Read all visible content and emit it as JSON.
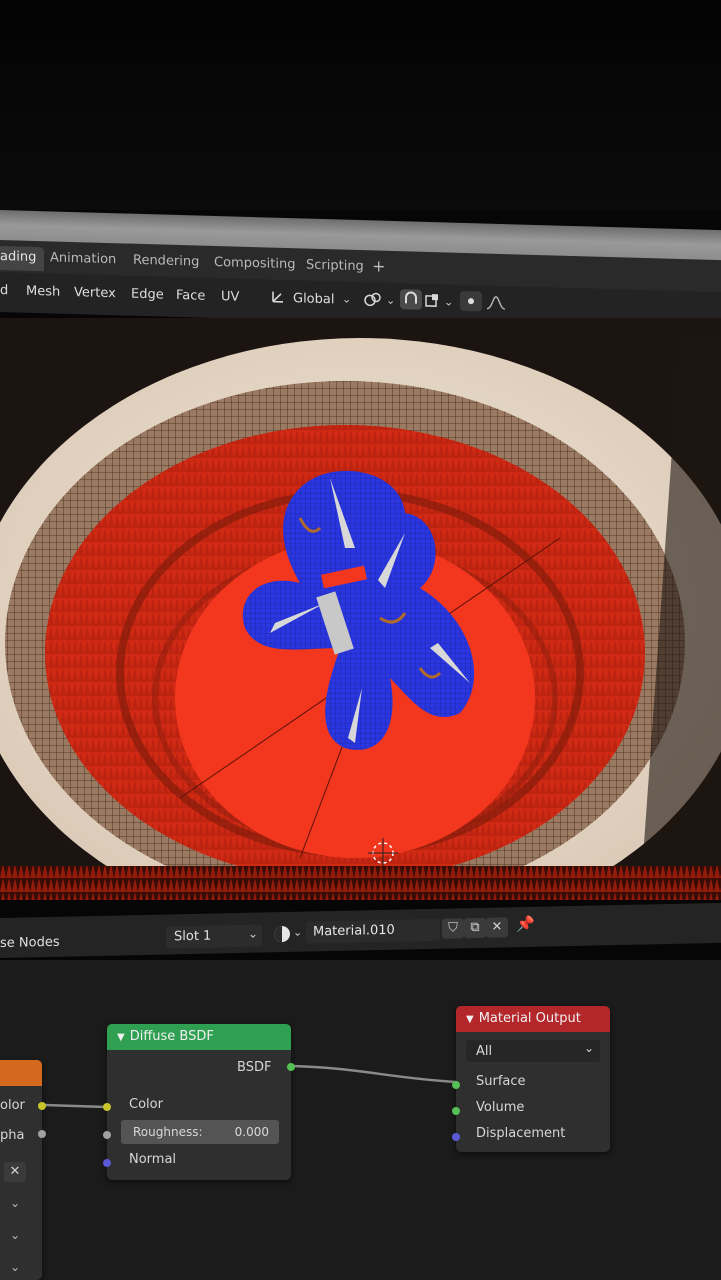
{
  "workspace_tabs": [
    {
      "label": "ading",
      "active": true
    },
    {
      "label": "Animation",
      "active": false
    },
    {
      "label": "Rendering",
      "active": false
    },
    {
      "label": "Compositing",
      "active": false
    },
    {
      "label": "Scripting",
      "active": false
    }
  ],
  "tab_add": "+",
  "header_menu": [
    "d",
    "Mesh",
    "Vertex",
    "Edge",
    "Face",
    "UV"
  ],
  "transform_orientation": "Global",
  "node_header": {
    "use_nodes_label": "se Nodes",
    "slot": "Slot 1",
    "material": "Material.010"
  },
  "nodes": {
    "diffuse": {
      "title": "Diffuse BSDF",
      "output": "BSDF",
      "color_label": "Color",
      "roughness_label": "Roughness:",
      "roughness_value": "0.000",
      "normal_label": "Normal"
    },
    "output": {
      "title": "Material Output",
      "target": "All",
      "surface": "Surface",
      "volume": "Volume",
      "displacement": "Displacement"
    },
    "left_partial": {
      "color_label": "olor",
      "alpha_label": "pha"
    }
  },
  "colors": {
    "diffuse_header": "#2f9f52",
    "output_header": "#b3262a",
    "left_header": "#d4691e",
    "socket_yellow": "#c7c52a",
    "socket_grey": "#a0a0a0",
    "socket_blue": "#5a5ad8",
    "socket_green": "#55c155",
    "mesh_red": "#f2371e",
    "mesh_blue": "#2430d8"
  }
}
